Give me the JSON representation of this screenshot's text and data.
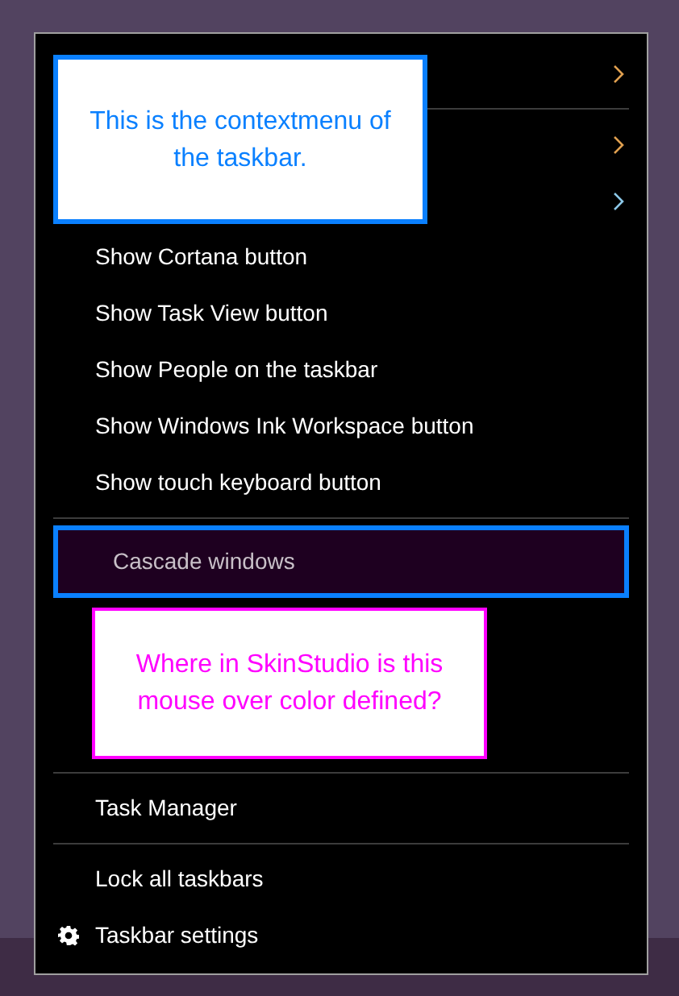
{
  "menu": {
    "items": [
      {
        "kind": "submenu",
        "color": "#e0a050"
      },
      {
        "kind": "separator"
      },
      {
        "kind": "submenu",
        "color": "#e0a050"
      },
      {
        "kind": "submenu",
        "color": "#8cc8e8"
      },
      {
        "kind": "item",
        "label": "Show Cortana button",
        "hovered": false
      },
      {
        "kind": "item",
        "label": "Show Task View button",
        "hovered": false
      },
      {
        "kind": "item",
        "label": "Show People on the taskbar",
        "hovered": false
      },
      {
        "kind": "item",
        "label": "Show Windows Ink Workspace button",
        "hovered": false
      },
      {
        "kind": "item",
        "label": "Show touch keyboard button",
        "hovered": false
      },
      {
        "kind": "separator"
      },
      {
        "kind": "item",
        "label": "Cascade windows",
        "hovered": true
      },
      {
        "kind": "note",
        "text": "Where in SkinStudio is this mouse over color defined?",
        "color": "#ff00ff"
      },
      {
        "kind": "separator"
      },
      {
        "kind": "item",
        "label": "Task Manager",
        "hovered": false
      },
      {
        "kind": "separator"
      },
      {
        "kind": "item",
        "label": "Lock all taskbars",
        "hovered": false
      },
      {
        "kind": "settings",
        "label": "Taskbar settings",
        "hovered": false
      }
    ]
  },
  "annotations": [
    {
      "text": "This is the contextmenu of the taskbar.",
      "color": "#0a80ff"
    }
  ]
}
